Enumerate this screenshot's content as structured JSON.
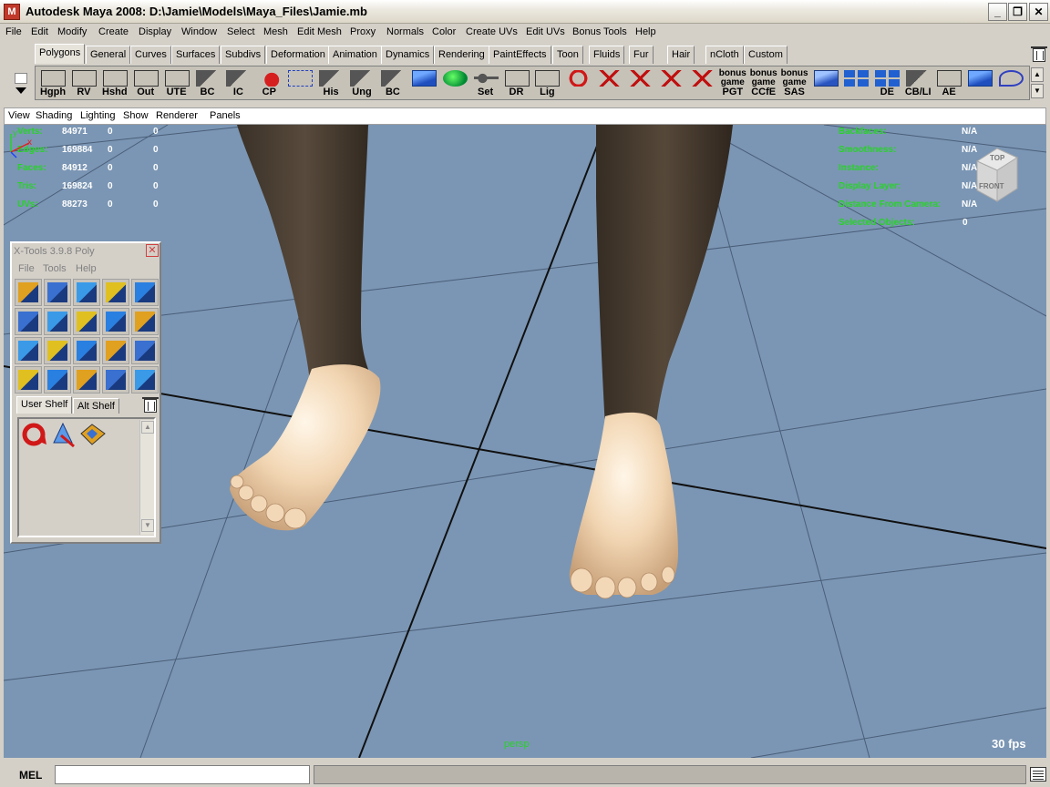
{
  "window": {
    "title": "Autodesk Maya 2008: D:\\Jamie\\Models\\Maya_Files\\Jamie.mb",
    "app_icon": "maya-icon",
    "controls": [
      "_",
      "❐",
      "✕"
    ]
  },
  "menubar": [
    "File",
    "Edit",
    "Modify",
    "Create",
    "Display",
    "Window",
    "Select",
    "Mesh",
    "Edit Mesh",
    "Proxy",
    "Normals",
    "Color",
    "Create UVs",
    "Edit UVs",
    "Bonus Tools",
    "Help"
  ],
  "shelf": {
    "tabs": [
      "Polygons",
      "General",
      "Curves",
      "Surfaces",
      "Subdivs",
      "Deformation",
      "Animation",
      "Dynamics",
      "Rendering",
      "PaintEffects",
      "Toon",
      "Fluids",
      "Fur",
      "Hair",
      "nCloth",
      "Custom"
    ],
    "active_tab": "Polygons",
    "buttons": [
      {
        "label": "Hgph",
        "icon": "box"
      },
      {
        "label": "RV",
        "icon": "box"
      },
      {
        "label": "Hshd",
        "icon": "box"
      },
      {
        "label": "Out",
        "icon": "box"
      },
      {
        "label": "UTE",
        "icon": "box"
      },
      {
        "label": "BC",
        "icon": "curve"
      },
      {
        "label": "IC",
        "icon": "curve"
      },
      {
        "label": "CP",
        "icon": "arrow"
      },
      {
        "label": "",
        "icon": "wire"
      },
      {
        "label": "His",
        "icon": "curve"
      },
      {
        "label": "Ung",
        "icon": "curve"
      },
      {
        "label": "BC",
        "icon": "curve"
      },
      {
        "label": "",
        "icon": "cube"
      },
      {
        "label": "",
        "icon": "ball"
      },
      {
        "label": "Set",
        "icon": "key"
      },
      {
        "label": "DR",
        "icon": "box"
      },
      {
        "label": "Lig",
        "icon": "box"
      },
      {
        "label": "",
        "icon": "red"
      },
      {
        "label": "",
        "icon": "knot"
      },
      {
        "label": "",
        "icon": "knot"
      },
      {
        "label": "",
        "icon": "knot"
      },
      {
        "label": "",
        "icon": "knot"
      },
      {
        "label": "PGT",
        "icon": "bonus",
        "top": "bonus game"
      },
      {
        "label": "CCfE",
        "icon": "bonus",
        "top": "bonus game"
      },
      {
        "label": "SAS",
        "icon": "bonus",
        "top": "bonus game"
      },
      {
        "label": "",
        "icon": "cube2"
      },
      {
        "label": "",
        "icon": "grid"
      },
      {
        "label": "DE",
        "icon": "grid"
      },
      {
        "label": "CB/LI",
        "icon": "curve"
      },
      {
        "label": "AE",
        "icon": "box"
      },
      {
        "label": "",
        "icon": "cube"
      },
      {
        "label": "",
        "icon": "s"
      }
    ]
  },
  "panel_menu": [
    "View",
    "Shading",
    "Lighting",
    "Show",
    "Renderer",
    "Panels"
  ],
  "hud_left": [
    {
      "label": "Verts:",
      "v1": "84971",
      "v2": "0",
      "v3": "0"
    },
    {
      "label": "Edges:",
      "v1": "169884",
      "v2": "0",
      "v3": "0"
    },
    {
      "label": "Faces:",
      "v1": "84912",
      "v2": "0",
      "v3": "0"
    },
    {
      "label": "Tris:",
      "v1": "169824",
      "v2": "0",
      "v3": "0"
    },
    {
      "label": "UVs:",
      "v1": "88273",
      "v2": "0",
      "v3": "0"
    }
  ],
  "hud_right": [
    {
      "label": "Backfaces:",
      "value": "N/A"
    },
    {
      "label": "Smoothness:",
      "value": "N/A"
    },
    {
      "label": "Instance:",
      "value": "N/A"
    },
    {
      "label": "Display Layer:",
      "value": "N/A"
    },
    {
      "label": "Distance From Camera:",
      "value": "N/A"
    },
    {
      "label": "Selected Objects:",
      "value": "0"
    }
  ],
  "viewcube": {
    "top": "TOP",
    "front": "FRONT"
  },
  "camera_name": "persp",
  "fps": "30 fps",
  "axis": {
    "x": "x",
    "y": "y"
  },
  "xtools": {
    "title": "X-Tools 3.9.8 Poly",
    "close": "✕",
    "menu": [
      "File",
      "Tools",
      "Help"
    ],
    "tabs": [
      "User Shelf",
      "Alt Shelf"
    ],
    "active_tab": "User Shelf"
  },
  "command_line": {
    "label": "MEL",
    "value": ""
  }
}
